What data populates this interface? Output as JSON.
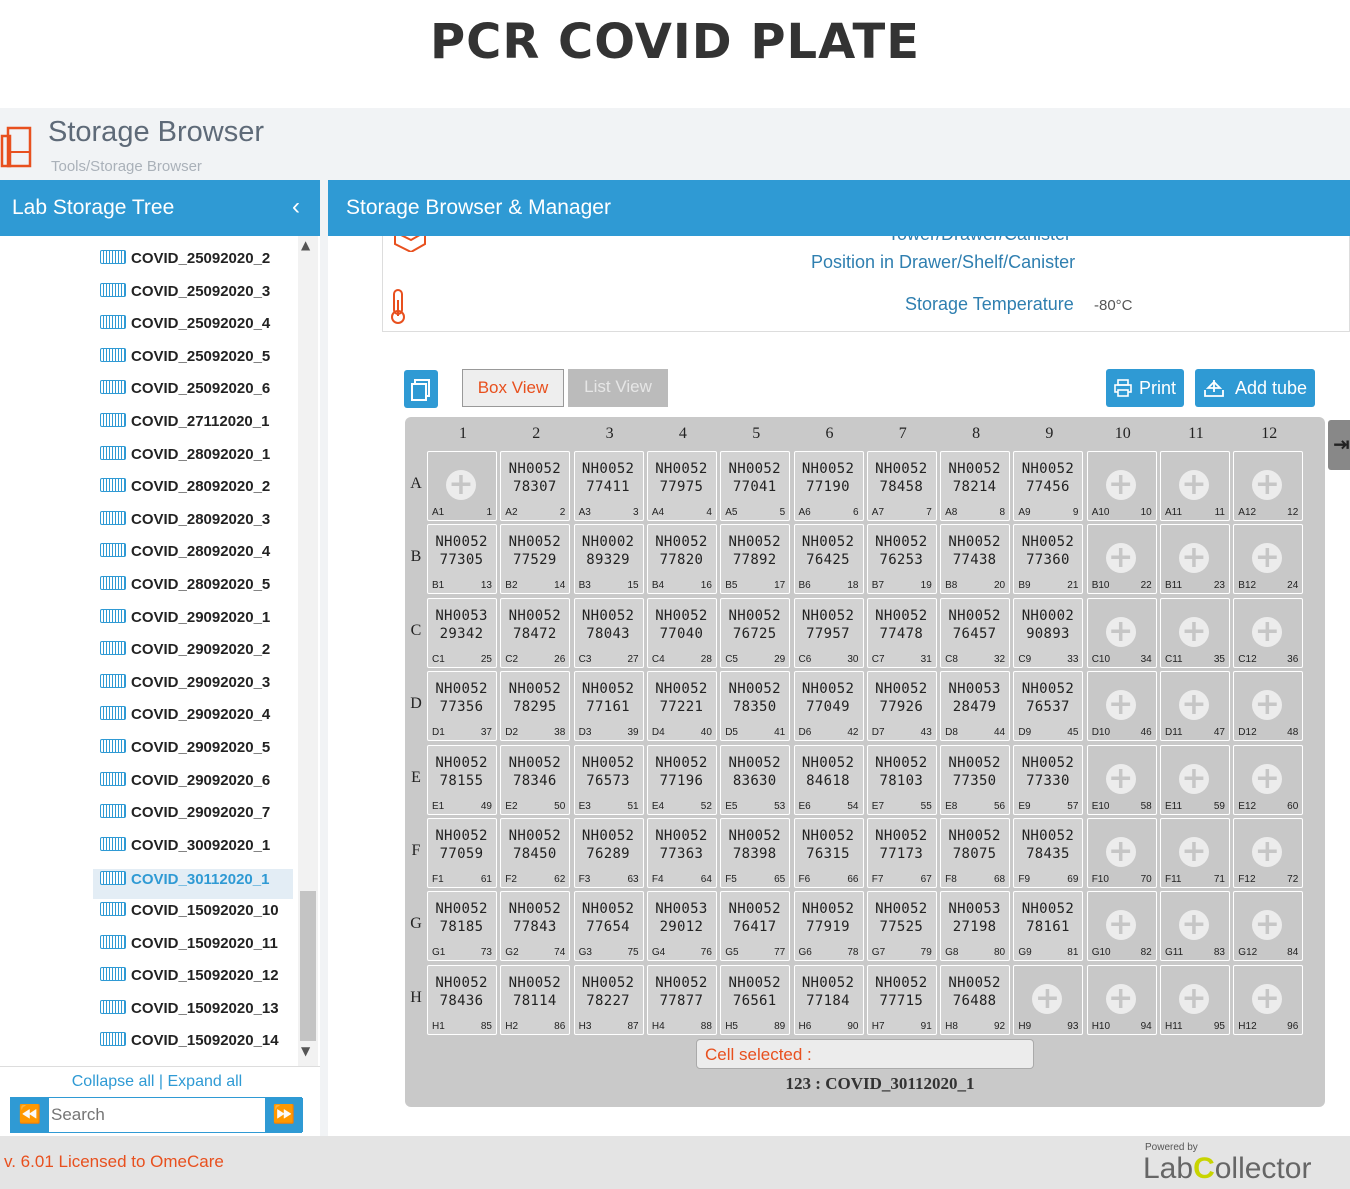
{
  "page_title": "PCR COVID PLATE",
  "header": {
    "title": "Storage Browser",
    "breadcrumb": "Tools/Storage Browser"
  },
  "left_panel": {
    "title": "Lab Storage Tree",
    "collapse_icon": "chevron-left-icon",
    "tree_items": [
      "COVID_25092020_2",
      "COVID_25092020_3",
      "COVID_25092020_4",
      "COVID_25092020_5",
      "COVID_25092020_6",
      "COVID_27112020_1",
      "COVID_28092020_1",
      "COVID_28092020_2",
      "COVID_28092020_3",
      "COVID_28092020_4",
      "COVID_28092020_5",
      "COVID_29092020_1",
      "COVID_29092020_2",
      "COVID_29092020_3",
      "COVID_29092020_4",
      "COVID_29092020_5",
      "COVID_29092020_6",
      "COVID_29092020_7",
      "COVID_30092020_1",
      "COVID_30112020_1",
      "COVID_15092020_10",
      "COVID_15092020_11",
      "COVID_15092020_12",
      "COVID_15092020_13",
      "COVID_15092020_14"
    ],
    "selected_item": "COVID_30112020_1",
    "collapse_expand": "Collapse all | Expand all",
    "search_placeholder": "Search"
  },
  "main": {
    "title": "Storage Browser & Manager",
    "info_cut_label": "Tower/Drawer/Canister",
    "position_label": "Position in Drawer/Shelf/Canister",
    "temp_label": "Storage Temperature",
    "temp_value": "-80°C",
    "tab_box": "Box View",
    "tab_list": "List View",
    "print_label": "Print",
    "add_tube_label": "Add tube",
    "columns": [
      "1",
      "2",
      "3",
      "4",
      "5",
      "6",
      "7",
      "8",
      "9",
      "10",
      "11",
      "12"
    ],
    "rows": [
      "A",
      "B",
      "C",
      "D",
      "E",
      "F",
      "G",
      "H"
    ],
    "wells": [
      [
        "",
        "NH0052 78307",
        "NH0052 77411",
        "NH0052 77975",
        "NH0052 77041",
        "NH0052 77190",
        "NH0052 78458",
        "NH0052 78214",
        "NH0052 77456",
        "",
        "",
        ""
      ],
      [
        "NH0052 77305",
        "NH0052 77529",
        "NH0002 89329",
        "NH0052 77820",
        "NH0052 77892",
        "NH0052 76425",
        "NH0052 76253",
        "NH0052 77438",
        "NH0052 77360",
        "",
        "",
        ""
      ],
      [
        "NH0053 29342",
        "NH0052 78472",
        "NH0052 78043",
        "NH0052 77040",
        "NH0052 76725",
        "NH0052 77957",
        "NH0052 77478",
        "NH0052 76457",
        "NH0002 90893",
        "",
        "",
        ""
      ],
      [
        "NH0052 77356",
        "NH0052 78295",
        "NH0052 77161",
        "NH0052 77221",
        "NH0052 78350",
        "NH0052 77049",
        "NH0052 77926",
        "NH0053 28479",
        "NH0052 76537",
        "",
        "",
        ""
      ],
      [
        "NH0052 78155",
        "NH0052 78346",
        "NH0052 76573",
        "NH0052 77196",
        "NH0052 83630",
        "NH0052 84618",
        "NH0052 78103",
        "NH0052 77350",
        "NH0052 77330",
        "",
        "",
        ""
      ],
      [
        "NH0052 77059",
        "NH0052 78450",
        "NH0052 76289",
        "NH0052 77363",
        "NH0052 78398",
        "NH0052 76315",
        "NH0052 77173",
        "NH0052 78075",
        "NH0052 78435",
        "",
        "",
        ""
      ],
      [
        "NH0052 78185",
        "NH0052 77843",
        "NH0052 77654",
        "NH0053 29012",
        "NH0052 76417",
        "NH0052 77919",
        "NH0052 77525",
        "NH0053 27198",
        "NH0052 78161",
        "",
        "",
        ""
      ],
      [
        "NH0052 78436",
        "NH0052 78114",
        "NH0052 78227",
        "NH0052 77877",
        "NH0052 76561",
        "NH0052 77184",
        "NH0052 77715",
        "NH0052 76488",
        "",
        "",
        "",
        ""
      ]
    ],
    "cell_selected_label": "Cell selected :",
    "plate_name": "123 : COVID_30112020_1"
  },
  "footer": {
    "version": "v. 6.01 Licensed to OmeCare",
    "powered_by": "Powered by",
    "logo_a": "Lab",
    "logo_b": "C",
    "logo_c": "ollector"
  },
  "colors": {
    "accent": "#2f9ad4",
    "orange": "#e8501e",
    "plate_bg": "#c9c9c9"
  }
}
